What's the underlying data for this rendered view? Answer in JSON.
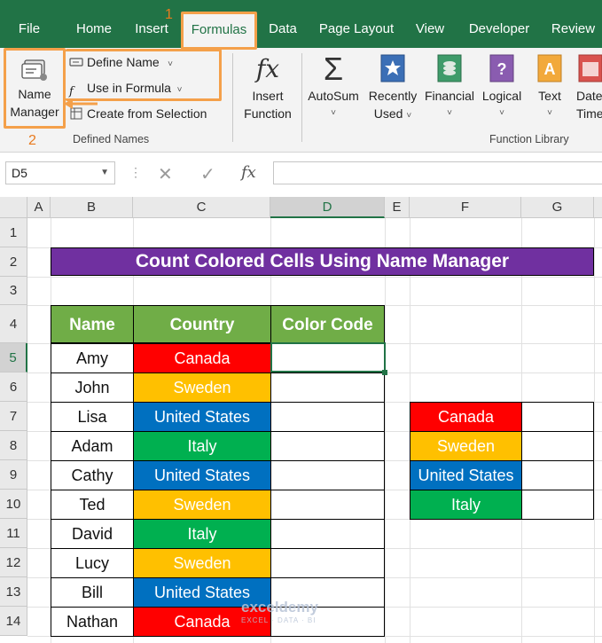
{
  "tabs": [
    "File",
    "Home",
    "Insert",
    "Formulas",
    "Data",
    "Page Layout",
    "View",
    "Developer",
    "Review"
  ],
  "ribbon": {
    "name_manager": [
      "Name",
      "Manager"
    ],
    "define_name": "Define Name",
    "use_in_formula": "Use in Formula",
    "create_from_selection": "Create from Selection",
    "defined_names_label": "Defined Names",
    "insert_function": [
      "Insert",
      "Function"
    ],
    "autosum": "AutoSum",
    "recently_used": [
      "Recently",
      "Used"
    ],
    "financial": "Financial",
    "logical": "Logical",
    "text": "Text",
    "date_time": [
      "Date",
      "Time"
    ],
    "function_library_label": "Function Library",
    "fx_symbol": "fx",
    "sigma_symbol": "Σ"
  },
  "annotations": {
    "step1": "1",
    "step2": "2"
  },
  "formula_bar": {
    "name_box": "D5",
    "fx": "fx",
    "cancel": "✕",
    "enter": "✓"
  },
  "columns": [
    "A",
    "B",
    "C",
    "D",
    "E",
    "F",
    "G"
  ],
  "rows": [
    "1",
    "2",
    "3",
    "4",
    "5",
    "6",
    "7",
    "8",
    "9",
    "10",
    "11",
    "12",
    "13",
    "14"
  ],
  "sheet": {
    "title": "Count Colored Cells Using Name Manager",
    "headers": [
      "Name",
      "Country",
      "Color Code"
    ],
    "data": [
      {
        "name": "Amy",
        "country": "Canada",
        "color": "#ff0000"
      },
      {
        "name": "John",
        "country": "Sweden",
        "color": "#ffc000"
      },
      {
        "name": "Lisa",
        "country": "United States",
        "color": "#0070c0"
      },
      {
        "name": "Adam",
        "country": "Italy",
        "color": "#00b050"
      },
      {
        "name": "Cathy",
        "country": "United States",
        "color": "#0070c0"
      },
      {
        "name": "Ted",
        "country": "Sweden",
        "color": "#ffc000"
      },
      {
        "name": "David",
        "country": "Italy",
        "color": "#00b050"
      },
      {
        "name": "Lucy",
        "country": "Sweden",
        "color": "#ffc000"
      },
      {
        "name": "Bill",
        "country": "United States",
        "color": "#0070c0"
      },
      {
        "name": "Nathan",
        "country": "Canada",
        "color": "#ff0000"
      }
    ],
    "legend": [
      {
        "country": "Canada",
        "color": "#ff0000"
      },
      {
        "country": "Sweden",
        "color": "#ffc000"
      },
      {
        "country": "United States",
        "color": "#0070c0"
      },
      {
        "country": "Italy",
        "color": "#00b050"
      }
    ]
  },
  "watermark": {
    "brand": "exceldemy",
    "tagline": "EXCEL · DATA · BI"
  },
  "colors": {
    "excel_green": "#217346",
    "header_green": "#70ad47",
    "title_purple": "#7030a0",
    "annotation_orange": "#f4a04a"
  }
}
